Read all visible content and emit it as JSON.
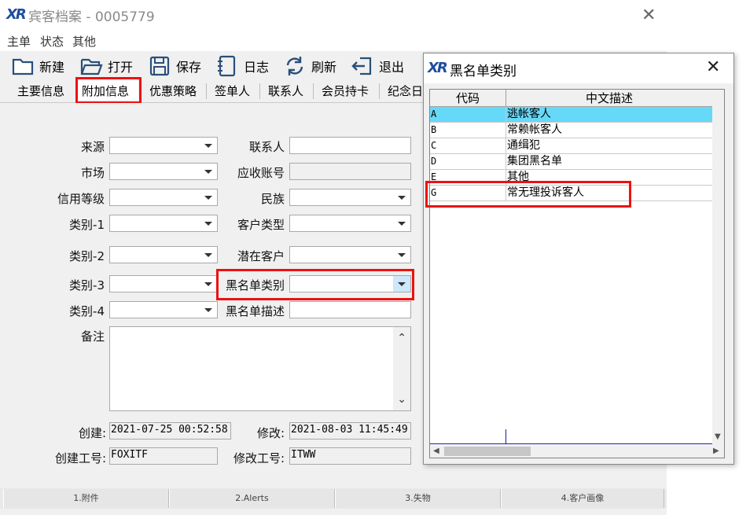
{
  "main_window": {
    "title": "宾客档案 - 0005779",
    "menu": [
      "主单",
      "状态",
      "其他"
    ],
    "toolbar": [
      {
        "label": "新建",
        "icon": "folder-new-icon"
      },
      {
        "label": "打开",
        "icon": "folder-open-icon"
      },
      {
        "label": "保存",
        "icon": "save-icon"
      },
      {
        "label": "日志",
        "icon": "log-icon"
      },
      {
        "label": "刷新",
        "icon": "refresh-icon"
      },
      {
        "label": "退出",
        "icon": "exit-icon"
      }
    ],
    "tabs": [
      "主要信息",
      "附加信息",
      "优惠策略",
      "签单人",
      "联系人",
      "会员持卡",
      "纪念日"
    ],
    "active_tab": "附加信息",
    "form": {
      "source_label": "来源",
      "market_label": "市场",
      "credit_label": "信用等级",
      "cat1_label": "类别-1",
      "cat2_label": "类别-2",
      "cat3_label": "类别-3",
      "cat4_label": "类别-4",
      "contact_label": "联系人",
      "ar_label": "应收账号",
      "ethnic_label": "民族",
      "cust_type_label": "客户类型",
      "potential_label": "潜在客户",
      "blacklist_cat_label": "黑名单类别",
      "blacklist_desc_label": "黑名单描述",
      "remark_label": "备注",
      "created_label": "创建:",
      "created_value": "2021-07-25 00:52:58",
      "modified_label": "修改:",
      "modified_value": "2021-08-03 11:45:49",
      "creator_label": "创建工号:",
      "creator_value": "FOXITF",
      "modifier_label": "修改工号:",
      "modifier_value": "ITWW"
    },
    "status_tabs": [
      "1.附件",
      "2.Alerts",
      "3.失物",
      "4.客户画像"
    ]
  },
  "dialog": {
    "title": "黑名单类别",
    "columns": [
      "代码",
      "中文描述"
    ],
    "rows": [
      {
        "code": "A",
        "desc": "逃帐客人",
        "selected": true
      },
      {
        "code": "B",
        "desc": "常赖帐客人",
        "selected": false
      },
      {
        "code": "C",
        "desc": "通缉犯",
        "selected": false
      },
      {
        "code": "D",
        "desc": "集团黑名单",
        "selected": false
      },
      {
        "code": "E",
        "desc": "其他",
        "selected": false
      },
      {
        "code": "G",
        "desc": "常无理投诉客人",
        "selected": false
      }
    ]
  },
  "colors": {
    "accent_red": "#ee1111",
    "selection_cyan": "#67d9f8",
    "logo_blue": "#1f4e9e"
  }
}
